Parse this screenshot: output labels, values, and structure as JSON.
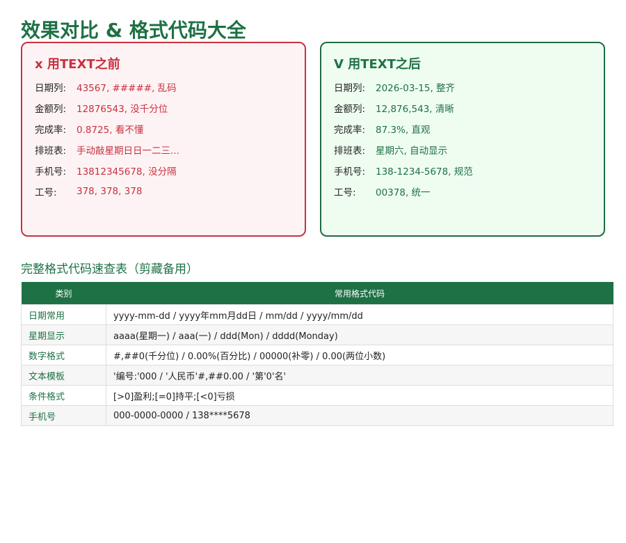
{
  "page": {
    "title": "效果对比 & 格式代码大全"
  },
  "before": {
    "heading": "x 用TEXT之前",
    "rows": [
      {
        "label": "日期列:",
        "value": "43567, #####, 乱码"
      },
      {
        "label": "金额列:",
        "value": "12876543, 没千分位"
      },
      {
        "label": "完成率:",
        "value": "0.8725, 看不懂"
      },
      {
        "label": "排班表:",
        "value": "手动敲星期日日一二三..."
      },
      {
        "label": "手机号:",
        "value": "13812345678, 没分隔"
      },
      {
        "label": "工号:",
        "value": "378, 378, 378"
      }
    ]
  },
  "after": {
    "heading": "V 用TEXT之后",
    "rows": [
      {
        "label": "日期列:",
        "value": "2026-03-15, 整齐"
      },
      {
        "label": "金额列:",
        "value": "12,876,543, 清晰"
      },
      {
        "label": "完成率:",
        "value": "87.3%, 直观"
      },
      {
        "label": "排班表:",
        "value": "星期六, 自动显示"
      },
      {
        "label": "手机号:",
        "value": "138-1234-5678, 规范"
      },
      {
        "label": "工号:",
        "value": "00378, 统一"
      }
    ]
  },
  "reference": {
    "title": "完整格式代码速查表（剪藏备用）",
    "headers": [
      "类别",
      "常用格式代码"
    ],
    "rows": [
      {
        "category": "日期常用",
        "code": "yyyy-mm-dd / yyyy年mm月dd日 / mm/dd / yyyy/mm/dd"
      },
      {
        "category": "星期显示",
        "code": "aaaa(星期一) / aaa(一) / ddd(Mon) / dddd(Monday)"
      },
      {
        "category": "数字格式",
        "code": "#,##0(千分位) / 0.00%(百分比) / 00000(补零) / 0.00(两位小数)"
      },
      {
        "category": "文本模板",
        "code": "'编号:'000 / '人民币'#,##0.00 / '第'0'名'"
      },
      {
        "category": "条件格式",
        "code": "[>0]盈利;[=0]持平;[<0]亏损"
      },
      {
        "category": "手机号",
        "code": "000-0000-0000 / 138****5678"
      }
    ]
  }
}
